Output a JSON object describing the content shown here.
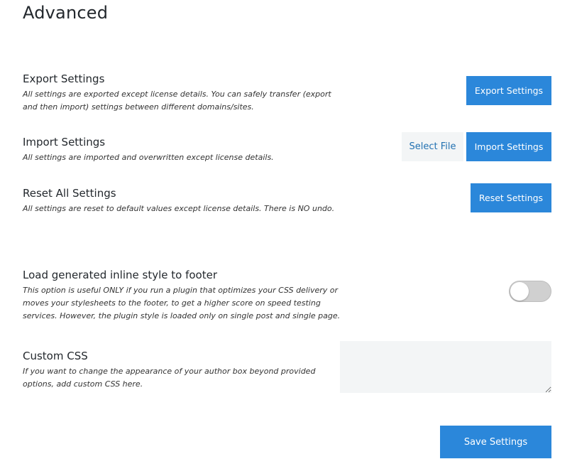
{
  "page": {
    "title": "Advanced"
  },
  "export": {
    "title": "Export Settings",
    "description_line1": "All settings are exported except license details. You can safely transfer (export",
    "description_line2": "and then import) settings between different domains/sites.",
    "button_label": "Export Settings"
  },
  "import": {
    "title": "Import Settings",
    "description": "All settings are imported and overwritten except license details.",
    "select_file_label": "Select File",
    "button_label": "Import Settings"
  },
  "reset": {
    "title": "Reset All Settings",
    "description": "All settings are reset to default values except license details. There is NO undo.",
    "button_label": "Reset Settings"
  },
  "footer_style": {
    "title": "Load generated inline style to footer",
    "description_line1": "This option is useful ONLY if you run a plugin that optimizes your CSS delivery or",
    "description_line2": "moves your stylesheets to the footer, to get a higher score on speed testing",
    "description_line3": "services. However, the plugin style is loaded only on single post and single page.",
    "toggle_on": false
  },
  "custom_css": {
    "title": "Custom CSS",
    "description_line1": "If you want to change the appearance of your author box beyond provided",
    "description_line2": "options, add custom CSS here.",
    "value": ""
  },
  "save": {
    "button_label": "Save Settings"
  },
  "colors": {
    "accent": "#2b87da",
    "field_background": "#f3f5f6"
  }
}
